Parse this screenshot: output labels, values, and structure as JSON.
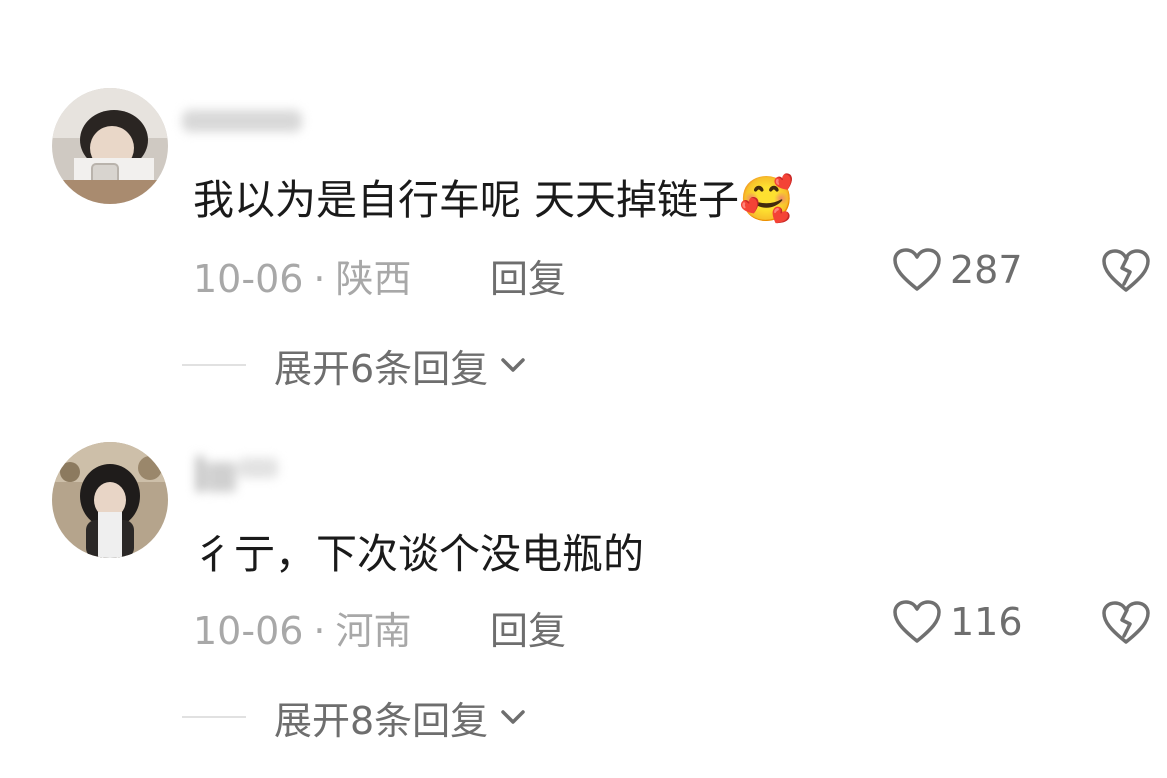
{
  "comments": [
    {
      "username": "",
      "text": "我以为是自行车呢 天天掉链子",
      "emoji": "🥰",
      "date": "10-06",
      "separator": "·",
      "location": "陕西",
      "reply_label": "回复",
      "likes": "287",
      "expand_label": "展开6条回复"
    },
    {
      "username": "",
      "text": "彳亍，下次谈个没电瓶的",
      "date": "10-06",
      "separator": "·",
      "location": "河南",
      "reply_label": "回复",
      "likes": "116",
      "expand_label": "展开8条回复"
    }
  ],
  "icons": {
    "like": "heart-outline-icon",
    "dislike": "broken-heart-icon",
    "expand": "chevron-down-icon"
  },
  "colors": {
    "primary_text": "#1a1a1a",
    "secondary_text": "#6e6e6e",
    "muted_text": "#a8a8a8",
    "divider": "#e1e1e1"
  }
}
